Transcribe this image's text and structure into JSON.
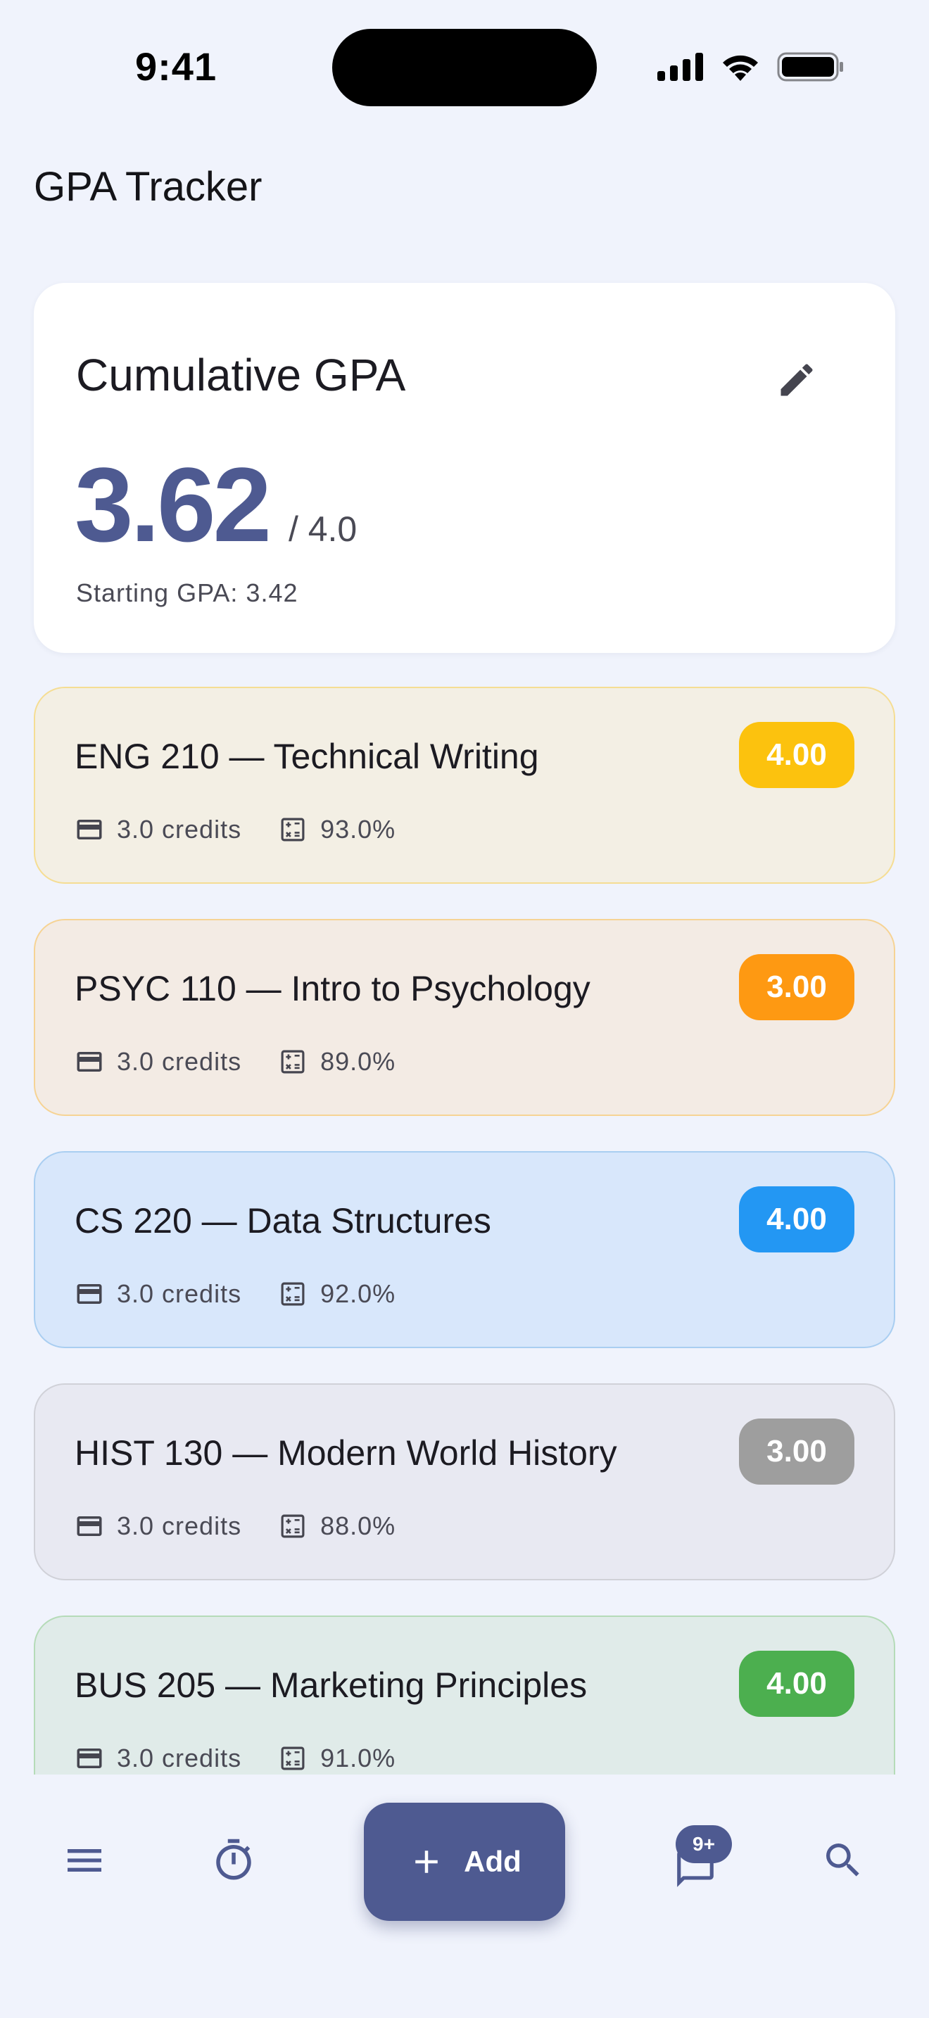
{
  "status_bar": {
    "time": "9:41"
  },
  "app": {
    "title": "GPA Tracker"
  },
  "gpa_card": {
    "title": "Cumulative GPA",
    "value": "3.62",
    "scale": "/ 4.0",
    "starting": "Starting GPA: 3.42"
  },
  "courses": [
    {
      "name": "ENG 210 — Technical Writing",
      "grade": "4.00",
      "credits": "3.0 credits",
      "percent": "93.0%",
      "bg": "#f3efe4",
      "border": "#f5dd93",
      "badge_color": "#fcc20e"
    },
    {
      "name": "PSYC 110 — Intro to Psychology",
      "grade": "3.00",
      "credits": "3.0 credits",
      "percent": "89.0%",
      "bg": "#f3ebe4",
      "border": "#f6d394",
      "badge_color": "#fe9912"
    },
    {
      "name": "CS 220 — Data Structures",
      "grade": "4.00",
      "credits": "3.0 credits",
      "percent": "92.0%",
      "bg": "#d8e7fb",
      "border": "#a9cef1",
      "badge_color": "#2397f3"
    },
    {
      "name": "HIST 130 — Modern World History",
      "grade": "3.00",
      "credits": "3.0 credits",
      "percent": "88.0%",
      "bg": "#e8e9f2",
      "border": "#d0d1d8",
      "badge_color": "#9e9e9e"
    },
    {
      "name": "BUS 205 — Marketing Principles",
      "grade": "4.00",
      "credits": "3.0 credits",
      "percent": "91.0%",
      "bg": "#e0ebe9",
      "border": "#b5dbb8",
      "badge_color": "#4caf4f"
    }
  ],
  "bottom_nav": {
    "add_label": "Add",
    "messages_badge": "9+",
    "icons": [
      "menu-icon",
      "timer-icon",
      "add-icon",
      "chat-icon",
      "search-icon"
    ]
  },
  "colors": {
    "primary": "#4e5a91",
    "background": "#f0f3fc"
  }
}
